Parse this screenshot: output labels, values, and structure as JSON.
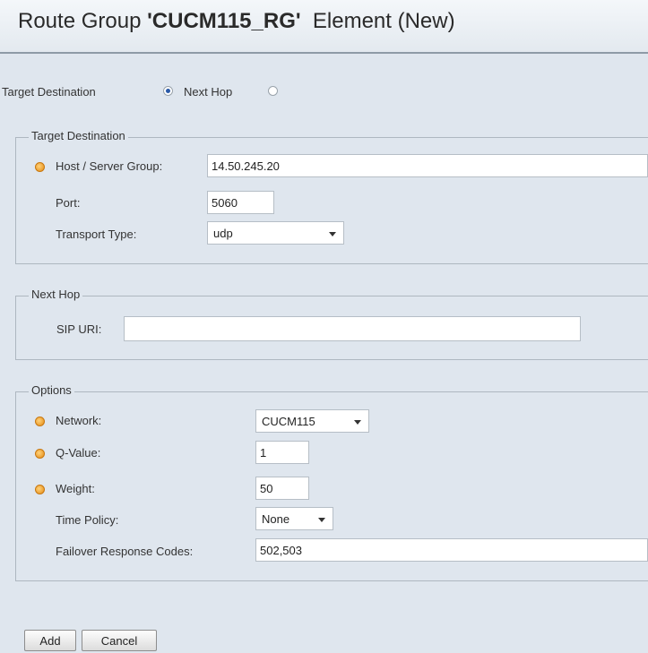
{
  "header": {
    "title_prefix": "Route Group ",
    "title_name": "'CUCM115_RG'",
    "title_suffix": "  Element (New)"
  },
  "routing": {
    "target_destination_label": "Target Destination",
    "next_hop_label": "Next Hop",
    "selected": "Target Destination"
  },
  "target_destination": {
    "legend": "Target Destination",
    "host_label": "Host / Server Group:",
    "host_value": "14.50.245.20",
    "port_label": "Port:",
    "port_value": "5060",
    "transport_label": "Transport Type:",
    "transport_value": "udp"
  },
  "next_hop": {
    "legend": "Next Hop",
    "sip_uri_label": "SIP URI:",
    "sip_uri_value": ""
  },
  "options": {
    "legend": "Options",
    "network_label": "Network:",
    "network_value": "CUCM115",
    "qvalue_label": "Q-Value:",
    "qvalue_value": "1",
    "weight_label": "Weight:",
    "weight_value": "50",
    "time_policy_label": "Time Policy:",
    "time_policy_value": "None",
    "failover_label": "Failover Response Codes:",
    "failover_value": "502,503"
  },
  "buttons": {
    "add": "Add",
    "cancel": "Cancel"
  },
  "colors": {
    "required_marker": "#f0a030",
    "background": "#dfe6ee",
    "radio_selected": "#2a5aa8"
  }
}
